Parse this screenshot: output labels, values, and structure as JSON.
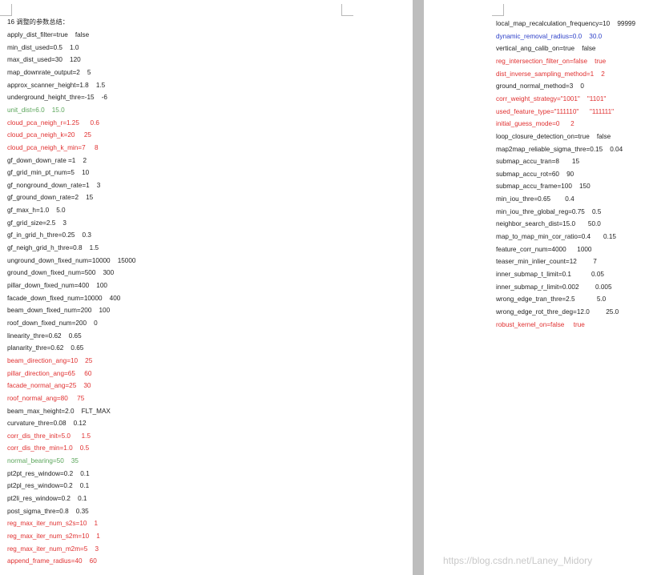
{
  "left_page": {
    "title": "16 调整的参数总结：",
    "lines": [
      {
        "text": "apply_dist_filter=true    false",
        "color": "black"
      },
      {
        "text": "min_dist_used=0.5    1.0",
        "color": "black"
      },
      {
        "text": "max_dist_used=30    120",
        "color": "black"
      },
      {
        "text": "map_downrate_output=2    5",
        "color": "black"
      },
      {
        "text": "approx_scanner_height=1.8    1.5",
        "color": "black"
      },
      {
        "text": "underground_height_thre=-15    -6",
        "color": "black"
      },
      {
        "text": "unit_dist=6.0    15.0",
        "color": "green"
      },
      {
        "text": "cloud_pca_neigh_r=1.25      0.6",
        "color": "red"
      },
      {
        "text": "cloud_pca_neigh_k=20     25",
        "color": "red"
      },
      {
        "text": "cloud_pca_neigh_k_min=7     8",
        "color": "red"
      },
      {
        "text": "gf_down_down_rate =1    2",
        "color": "black"
      },
      {
        "text": "gf_grid_min_pt_num=5    10",
        "color": "black"
      },
      {
        "text": "gf_nonground_down_rate=1    3",
        "color": "black"
      },
      {
        "text": "gf_ground_down_rate=2    15",
        "color": "black"
      },
      {
        "text": "gf_max_h=1.0    5.0",
        "color": "black"
      },
      {
        "text": "gf_grid_size=2.5    3",
        "color": "black"
      },
      {
        "text": "gf_in_grid_h_thre=0.25    0.3",
        "color": "black"
      },
      {
        "text": "gf_neigh_grid_h_thre=0.8    1.5",
        "color": "black"
      },
      {
        "text": "unground_down_fixed_num=10000    15000",
        "color": "black"
      },
      {
        "text": "ground_down_fixed_num=500    300",
        "color": "black"
      },
      {
        "text": "pillar_down_fixed_num=400    100",
        "color": "black"
      },
      {
        "text": "facade_down_fixed_num=10000    400",
        "color": "black"
      },
      {
        "text": "beam_down_fixed_num=200    100",
        "color": "black"
      },
      {
        "text": "roof_down_fixed_num=200    0",
        "color": "black"
      },
      {
        "text": "linearity_thre=0.62    0.65",
        "color": "black"
      },
      {
        "text": "planarity_thre=0.62    0.65",
        "color": "black"
      },
      {
        "text": "beam_direction_ang=10    25",
        "color": "red"
      },
      {
        "text": "pillar_direction_ang=65     60",
        "color": "red"
      },
      {
        "text": "facade_normal_ang=25    30",
        "color": "red"
      },
      {
        "text": "roof_normal_ang=80     75",
        "color": "red"
      },
      {
        "text": "beam_max_height=2.0    FLT_MAX",
        "color": "black"
      },
      {
        "text": "curvature_thre=0.08    0.12",
        "color": "black"
      },
      {
        "text": "corr_dis_thre_init=5.0      1.5",
        "color": "red"
      },
      {
        "text": "corr_dis_thre_min=1.0    0.5",
        "color": "red"
      },
      {
        "text": "normal_bearing=50    35",
        "color": "green"
      },
      {
        "text": "pt2pt_res_window=0.2    0.1",
        "color": "black"
      },
      {
        "text": "pt2pl_res_window=0.2    0.1",
        "color": "black"
      },
      {
        "text": "pt2li_res_window=0.2    0.1",
        "color": "black"
      },
      {
        "text": "post_sigma_thre=0.8    0.35",
        "color": "black"
      },
      {
        "text": "reg_max_iter_num_s2s=10    1",
        "color": "red"
      },
      {
        "text": "reg_max_iter_num_s2m=10    1",
        "color": "red"
      },
      {
        "text": "reg_max_iter_num_m2m=5    3",
        "color": "red"
      },
      {
        "text": "append_frame_radius=40    60",
        "color": "red"
      }
    ]
  },
  "right_page": {
    "lines": [
      {
        "text": "local_map_recalculation_frequency=10    99999",
        "color": "black"
      },
      {
        "text": "dynamic_removal_radius=0.0    30.0",
        "color": "blue"
      },
      {
        "text": "vertical_ang_calib_on=true    false",
        "color": "black"
      },
      {
        "text": "reg_intersection_filter_on=false    true",
        "color": "red"
      },
      {
        "text": "dist_inverse_sampling_method=1    2",
        "color": "red"
      },
      {
        "text": "ground_normal_method=3    0",
        "color": "black"
      },
      {
        "text": "corr_weight_strategy=\"1001\"    \"1101\"",
        "color": "red"
      },
      {
        "text": "used_feature_type=\"111110\"      \"111111\"",
        "color": "red"
      },
      {
        "text": "initial_guess_mode=0      2",
        "color": "red"
      },
      {
        "text": "loop_closure_detection_on=true    false",
        "color": "black"
      },
      {
        "text": "map2map_reliable_sigma_thre=0.15    0.04",
        "color": "black"
      },
      {
        "text": "submap_accu_tran=8       15",
        "color": "black"
      },
      {
        "text": "submap_accu_rot=60    90",
        "color": "black"
      },
      {
        "text": "submap_accu_frame=100    150",
        "color": "black"
      },
      {
        "text": "min_iou_thre=0.65        0.4",
        "color": "black"
      },
      {
        "text": "min_iou_thre_global_reg=0.75    0.5",
        "color": "black"
      },
      {
        "text": "neighbor_search_dist=15.0       50.0",
        "color": "black"
      },
      {
        "text": "map_to_map_min_cor_ratio=0.4       0.15",
        "color": "black"
      },
      {
        "text": "feature_corr_num=4000      1000",
        "color": "black"
      },
      {
        "text": "teaser_min_inlier_count=12         7",
        "color": "black"
      },
      {
        "text": "inner_submap_t_limit=0.1           0.05",
        "color": "black"
      },
      {
        "text": "inner_submap_r_limit=0.002         0.005",
        "color": "black"
      },
      {
        "text": "wrong_edge_tran_thre=2.5            5.0",
        "color": "black"
      },
      {
        "text": "wrong_edge_rot_thre_deg=12.0         25.0",
        "color": "black"
      },
      {
        "text": "robust_kernel_on=false     true",
        "color": "red"
      }
    ]
  },
  "watermark": "https://blog.csdn.net/Laney_Midory"
}
